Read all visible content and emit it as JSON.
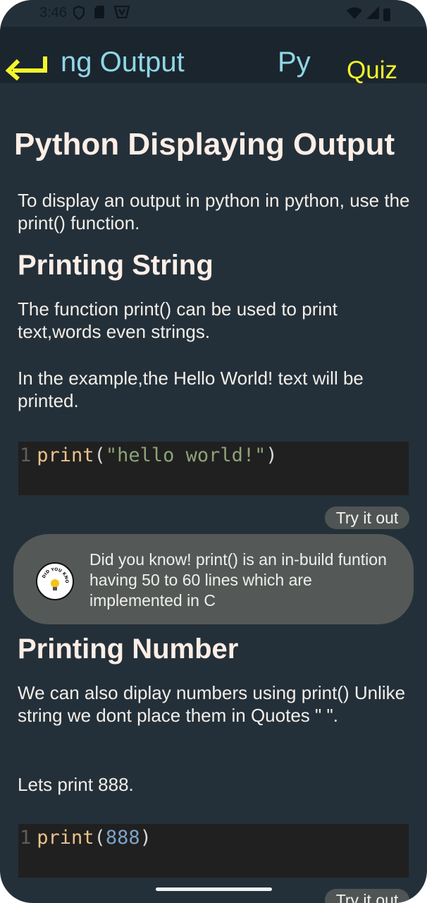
{
  "status_bar": {
    "time": "3:46",
    "left_icons": [
      "shield-icon",
      "sim-icon",
      "vpn-icon"
    ],
    "right_icons": [
      "wifi-icon",
      "signal-icon",
      "battery-icon"
    ]
  },
  "app_bar": {
    "back_icon": "arrow-back-icon",
    "marquee_text_1": "ng Output",
    "marquee_text_2": "Py",
    "quiz_label": "Quiz"
  },
  "content": {
    "title": "Python Displaying Output",
    "intro": "To display an output in python in python, use the print() function.",
    "section1": {
      "heading": "Printing String",
      "para1": "The function print() can be used to print text,words even strings.",
      "para2": "In the example,the Hello World! text will be printed.",
      "code": {
        "line_no": "1",
        "fn": "print",
        "open": "(",
        "arg": "\"hello world!\"",
        "close": ")"
      },
      "try_label": "Try it out"
    },
    "tip": {
      "icon": "did-you-know-bulb-icon",
      "badge_text": "DID YOU KNOW?",
      "text": "Did you know! print() is an in-build funtion having 50 to 60 lines which are implemented in C"
    },
    "section2": {
      "heading": "Printing Number",
      "para1": "We can also diplay numbers using print() Unlike string we dont place them in Quotes \" \".",
      "para2": "Lets print 888.",
      "code": {
        "line_no": "1",
        "fn": "print",
        "open": "(",
        "arg": "888",
        "close": ")"
      },
      "try_label": "Try it out"
    }
  },
  "colors": {
    "background": "#243039",
    "app_bar": "#1b252e",
    "title_text": "#8fd7e6",
    "quiz": "#f5f52a",
    "code_bg": "#202020"
  }
}
